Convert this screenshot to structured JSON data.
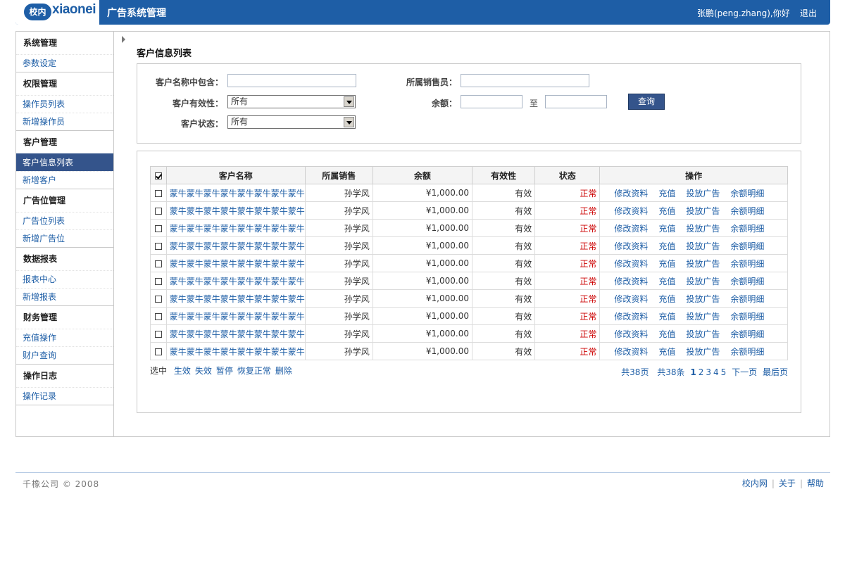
{
  "header": {
    "logo_badge": "校内",
    "logo_word": "xiaonei",
    "app_title": "广告系统管理",
    "user_greeting": "张鹏(peng.zhang),你好",
    "logout": "退出"
  },
  "sidebar": [
    {
      "title": "系统管理",
      "items": [
        "参数设定"
      ]
    },
    {
      "title": "权限管理",
      "items": [
        "操作员列表",
        "新增操作员"
      ]
    },
    {
      "title": "客户管理",
      "items": [
        "客户信息列表",
        "新增客户"
      ]
    },
    {
      "title": "广告位管理",
      "items": [
        "广告位列表",
        "新增广告位"
      ]
    },
    {
      "title": "数据报表",
      "items": [
        "报表中心",
        "新增报表"
      ]
    },
    {
      "title": "财务管理",
      "items": [
        "充值操作",
        "财户查询"
      ]
    },
    {
      "title": "操作日志",
      "items": [
        "操作记录"
      ]
    }
  ],
  "active_menu": "客户信息列表",
  "page_title": "客户信息列表",
  "search": {
    "name_label": "客户名称中包含：",
    "name_value": "",
    "sales_label": "所属销售员：",
    "sales_value": "",
    "valid_label": "客户有效性：",
    "valid_value": "所有",
    "balance_label": "余额：",
    "balance_from": "",
    "to_label": "至",
    "balance_to": "",
    "status_label": "客户状态：",
    "status_value": "所有",
    "query_button": "查询"
  },
  "table": {
    "headers": [
      "客户名称",
      "所属销售",
      "余额",
      "有效性",
      "状态",
      "操作"
    ],
    "operations": [
      "修改资料",
      "充值",
      "投放广告",
      "余额明细"
    ],
    "rows": [
      {
        "name": "蒙牛蒙牛蒙牛蒙牛蒙牛蒙牛蒙牛蒙牛",
        "sales": "孙学风",
        "balance": "¥1,000.00",
        "validity": "有效",
        "status": "正常"
      },
      {
        "name": "蒙牛蒙牛蒙牛蒙牛蒙牛蒙牛蒙牛蒙牛",
        "sales": "孙学风",
        "balance": "¥1,000.00",
        "validity": "有效",
        "status": "正常"
      },
      {
        "name": "蒙牛蒙牛蒙牛蒙牛蒙牛蒙牛蒙牛蒙牛",
        "sales": "孙学风",
        "balance": "¥1,000.00",
        "validity": "有效",
        "status": "正常"
      },
      {
        "name": "蒙牛蒙牛蒙牛蒙牛蒙牛蒙牛蒙牛蒙牛",
        "sales": "孙学风",
        "balance": "¥1,000.00",
        "validity": "有效",
        "status": "正常"
      },
      {
        "name": "蒙牛蒙牛蒙牛蒙牛蒙牛蒙牛蒙牛蒙牛",
        "sales": "孙学风",
        "balance": "¥1,000.00",
        "validity": "有效",
        "status": "正常"
      },
      {
        "name": "蒙牛蒙牛蒙牛蒙牛蒙牛蒙牛蒙牛蒙牛",
        "sales": "孙学风",
        "balance": "¥1,000.00",
        "validity": "有效",
        "status": "正常"
      },
      {
        "name": "蒙牛蒙牛蒙牛蒙牛蒙牛蒙牛蒙牛蒙牛",
        "sales": "孙学风",
        "balance": "¥1,000.00",
        "validity": "有效",
        "status": "正常"
      },
      {
        "name": "蒙牛蒙牛蒙牛蒙牛蒙牛蒙牛蒙牛蒙牛",
        "sales": "孙学风",
        "balance": "¥1,000.00",
        "validity": "有效",
        "status": "正常"
      },
      {
        "name": "蒙牛蒙牛蒙牛蒙牛蒙牛蒙牛蒙牛蒙牛",
        "sales": "孙学风",
        "balance": "¥1,000.00",
        "validity": "有效",
        "status": "正常"
      },
      {
        "name": "蒙牛蒙牛蒙牛蒙牛蒙牛蒙牛蒙牛蒙牛",
        "sales": "孙学风",
        "balance": "¥1,000.00",
        "validity": "有效",
        "status": "正常"
      }
    ]
  },
  "bulk_actions": {
    "label": "选中",
    "actions": [
      "生效",
      "失效",
      "暂停",
      "恢复正常",
      "删除"
    ]
  },
  "pagination": {
    "total_pages": "共38页",
    "total_items": "共38条",
    "pages": [
      "1",
      "2",
      "3",
      "4",
      "5"
    ],
    "current": "1",
    "next": "下一页",
    "last": "最后页"
  },
  "footer": {
    "copyright": "千橡公司 © 2008",
    "links": [
      "校内网",
      "关于",
      "帮助"
    ]
  },
  "colors": {
    "brand_blue": "#1e5ea6",
    "active_menu_bg": "#34548b",
    "status_red": "#cc0000"
  }
}
